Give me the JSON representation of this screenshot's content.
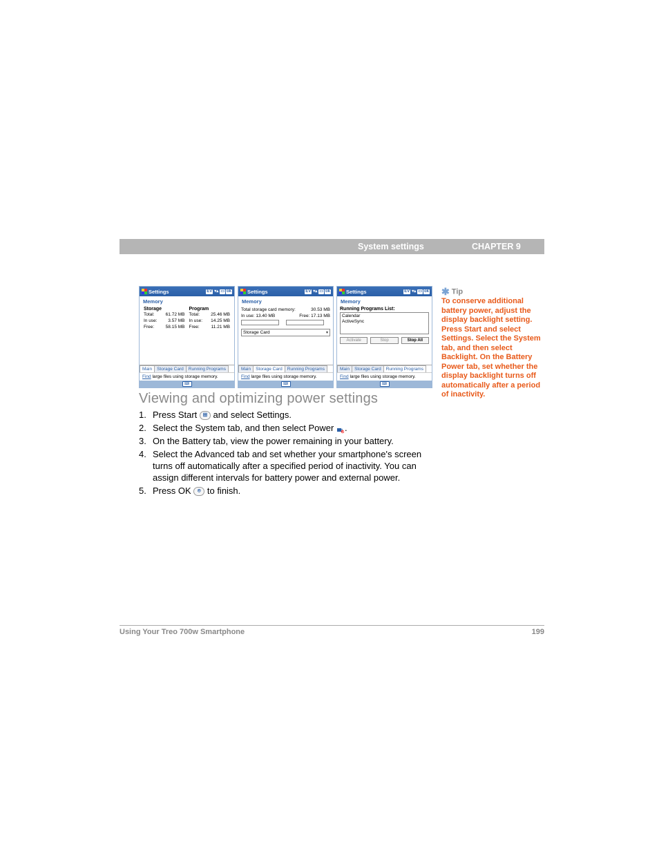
{
  "header": {
    "section": "System settings",
    "chapter": "CHAPTER 9"
  },
  "screenshots": {
    "title": "Settings",
    "subtitle": "Memory",
    "tabs": {
      "main": "Main",
      "storage": "Storage Card",
      "running": "Running Programs"
    },
    "find_prefix": "Find",
    "find_rest": " large files using storage memory.",
    "shot1": {
      "storage_head": "Storage",
      "program_head": "Program",
      "rows": {
        "total_lab": "Total:",
        "inuse_lab": "In use:",
        "free_lab": "Free:"
      },
      "storage": {
        "total": "61.72 MB",
        "inuse": "3.57 MB",
        "free": "58.15 MB"
      },
      "program": {
        "total": "25.46 MB",
        "inuse": "14.25 MB",
        "free": "11.21 MB"
      }
    },
    "shot2": {
      "total_lab": "Total storage card memory:",
      "total_val": "30.53 MB",
      "inuse_lab": "In use:",
      "inuse_val": "13.40 MB",
      "free_lab": "Free:",
      "free_val": "17.13 MB",
      "select": "Storage Card"
    },
    "shot3": {
      "head": "Running Programs List:",
      "items": [
        "Calendar",
        "ActiveSync"
      ],
      "btn_activate": "Activate",
      "btn_stop": "Stop",
      "btn_stopall": "Stop All"
    }
  },
  "section_title": "Viewing and optimizing power settings",
  "steps": [
    {
      "n": "1.",
      "pre": "Press Start ",
      "post": " and select Settings.",
      "icon": "start"
    },
    {
      "n": "2.",
      "pre": "Select the System tab, and then select Power ",
      "post": ".",
      "icon": "power"
    },
    {
      "n": "3.",
      "pre": "On the Battery tab, view the power remaining in your battery.",
      "post": "",
      "icon": ""
    },
    {
      "n": "4.",
      "pre": "Select the Advanced tab and set whether your smartphone's screen turns off automatically after a specified period of inactivity. You can assign different intervals for battery power and external power.",
      "post": "",
      "icon": ""
    },
    {
      "n": "5.",
      "pre": "Press OK ",
      "post": " to finish.",
      "icon": "ok"
    }
  ],
  "tip": {
    "label": "Tip",
    "body": "To conserve additional battery power, adjust the display backlight setting. Press Start and select Settings. Select the System tab, and then select Backlight. On the Battery Power tab, set whether the display backlight turns off automatically after a period of inactivity."
  },
  "footer": {
    "left": "Using Your Treo 700w Smartphone",
    "right": "199"
  }
}
